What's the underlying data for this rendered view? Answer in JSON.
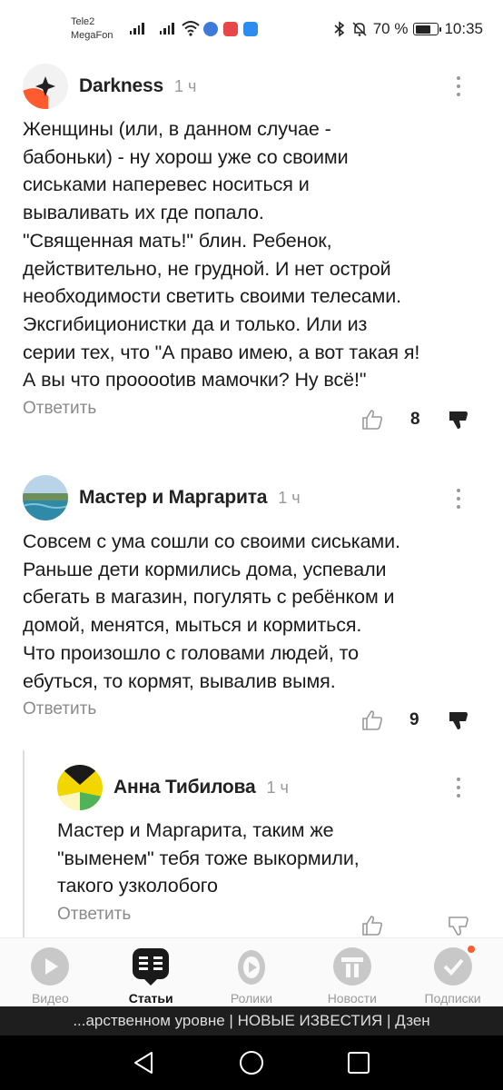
{
  "status_bar": {
    "carrier1": "Tele2",
    "carrier2": "MegaFon",
    "battery": "70 %",
    "battery_level": 0.7,
    "time": "10:35"
  },
  "comments": [
    {
      "author": "Darkness",
      "time": "1 ч",
      "text": "Женщины (или, в данном случае -\nбабоньки) - ну хорош уже со своими\nсиськами наперевес носиться и\nвываливать их где попало.\n\"Священная мать!\" блин. Ребенок,\nдействительно, не грудной. И нет острой\nнеобходимости светить своими телесами.\nЭксгибиционистки да и только. Или из\nсерии тех, что \"А право имею, а вот такая я!\nА вы что прооootив мамочки? Ну всё!\"",
      "reply": "Ответить",
      "likes": "8"
    },
    {
      "author": "Мастер и Маргарита",
      "time": "1 ч",
      "text": "Совсем с ума сошли со своими сиськами.\nРаньше дети кормились дома, успевали\nсбегать в магазин, погулять с ребёнком и\nдомой, менятся, мыться и кормиться.\nЧто произошло с головами людей, то\nебуться, то кормят, вывалив вымя.",
      "reply": "Ответить",
      "likes": "9"
    },
    {
      "author": "Анна Тибилова",
      "time": "1 ч",
      "text": "Мастер и Маргарита, таким же\n\"выменем\" тебя тоже выкормили,\nтакого узколобого",
      "reply": "Ответить",
      "likes": ""
    }
  ],
  "bottom_nav": [
    {
      "label": "Видео",
      "icon": "video-icon"
    },
    {
      "label": "Статьи",
      "icon": "articles-icon"
    },
    {
      "label": "Ролики",
      "icon": "clips-icon"
    },
    {
      "label": "Новости",
      "icon": "news-icon"
    },
    {
      "label": "Подписки",
      "icon": "subscriptions-icon"
    }
  ],
  "title_bar": "...арственном уровне | НОВЫЕ ИЗВЕСТИЯ | Дзен",
  "colors": {
    "accent_orange": "#ff5b2e",
    "text_primary": "#222222",
    "text_secondary": "#8a8a8a"
  }
}
